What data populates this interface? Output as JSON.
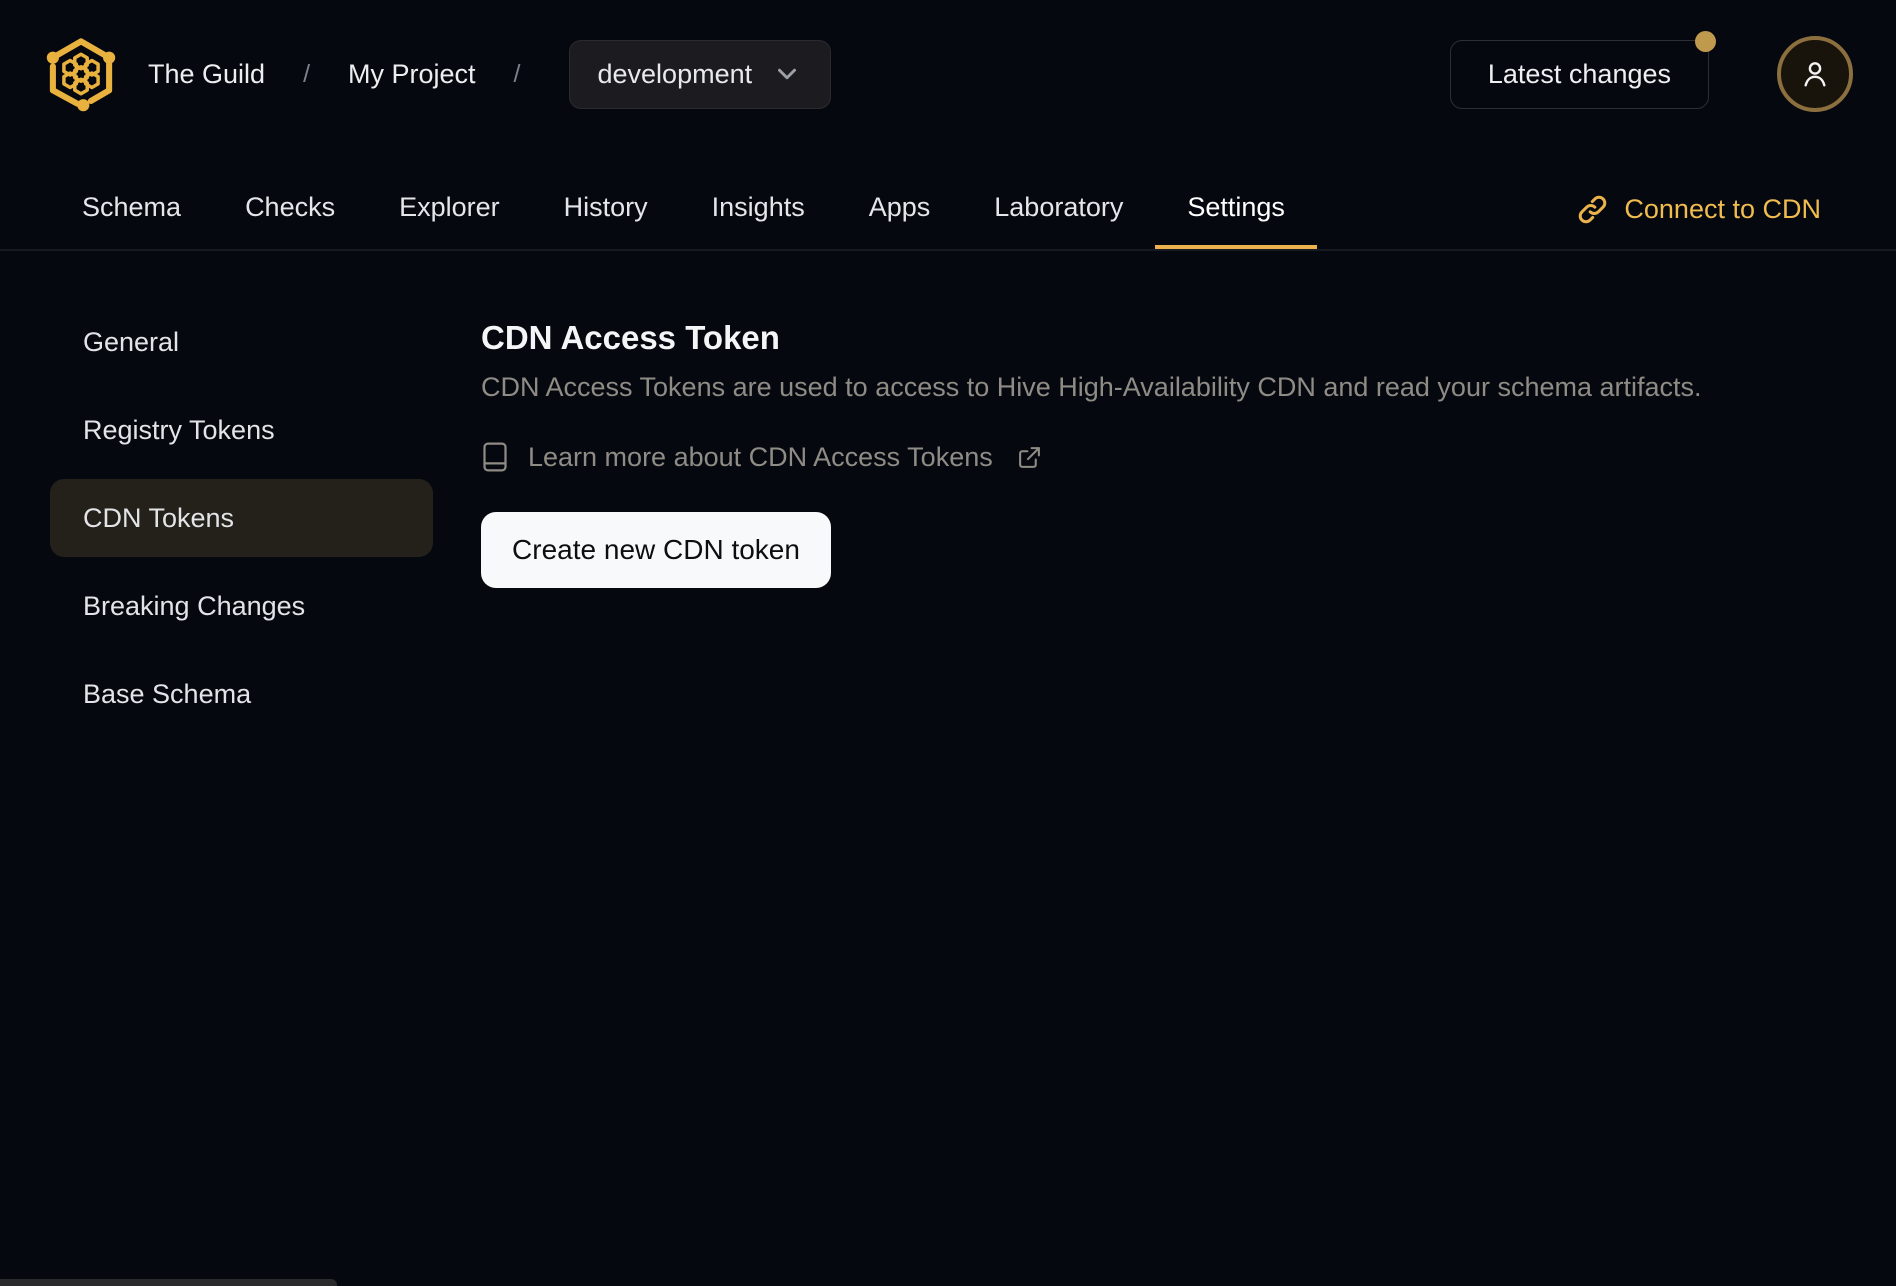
{
  "header": {
    "logo_name": "hive-logo",
    "breadcrumb": {
      "org": "The Guild",
      "separator": "/",
      "project": "My Project",
      "target": "development"
    },
    "latest_changes_label": "Latest changes",
    "has_notification_dot": true
  },
  "nav": {
    "tabs": [
      {
        "label": "Schema",
        "active": false
      },
      {
        "label": "Checks",
        "active": false
      },
      {
        "label": "Explorer",
        "active": false
      },
      {
        "label": "History",
        "active": false
      },
      {
        "label": "Insights",
        "active": false
      },
      {
        "label": "Apps",
        "active": false
      },
      {
        "label": "Laboratory",
        "active": false
      },
      {
        "label": "Settings",
        "active": true
      }
    ],
    "connect_cdn_label": "Connect to CDN"
  },
  "sidebar": {
    "items": [
      {
        "label": "General",
        "active": false
      },
      {
        "label": "Registry Tokens",
        "active": false
      },
      {
        "label": "CDN Tokens",
        "active": true
      },
      {
        "label": "Breaking Changes",
        "active": false
      },
      {
        "label": "Base Schema",
        "active": false
      }
    ]
  },
  "main": {
    "title": "CDN Access Token",
    "description": "CDN Access Tokens are used to access to Hive High-Availability CDN and read your schema artifacts.",
    "learn_more_label": "Learn more about CDN Access Tokens",
    "create_button_label": "Create new CDN token"
  },
  "icons": {
    "logo": "hive-hexagon-honeycomb",
    "dropdown": "chevron-down-icon",
    "avatar": "user-icon",
    "connect": "link-icon",
    "learn_more_left": "book-icon",
    "learn_more_right": "external-link-icon"
  },
  "colors": {
    "accent_gold": "#edb24c",
    "connect_link": "#f0bb4f",
    "notification_dot": "#bf9a4d",
    "page_background": "#060810",
    "selected_sidebar_item": "#232119",
    "muted_text": "#8f8b85",
    "create_button_background": "#f8f9fa"
  }
}
